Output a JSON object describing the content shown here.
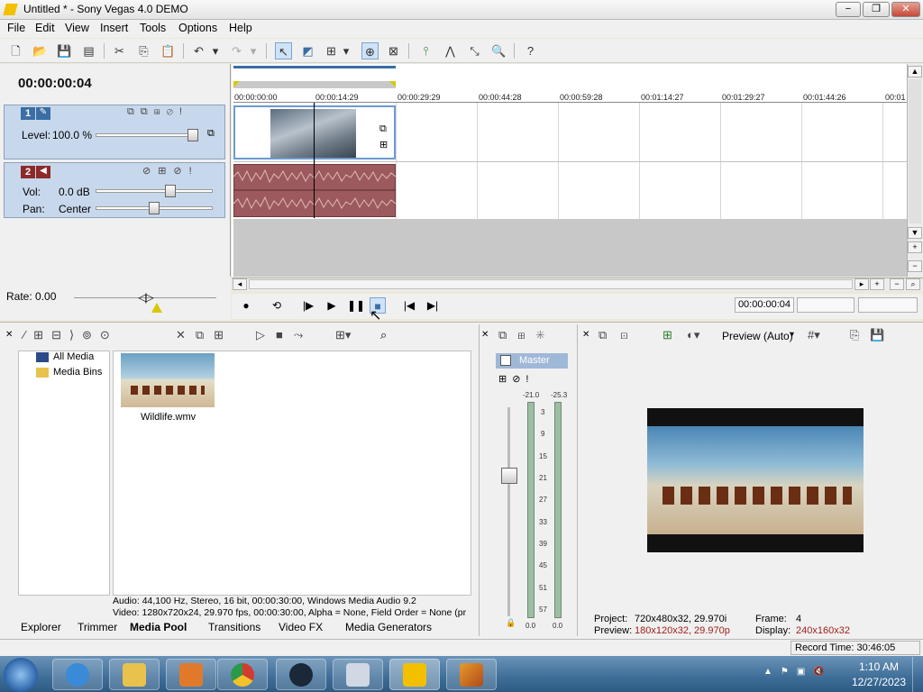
{
  "window": {
    "title": "Untitled * - Sony Vegas 4.0 DEMO",
    "minimize": "−",
    "restore": "❐",
    "close": "✕"
  },
  "menu": [
    "File",
    "Edit",
    "View",
    "Insert",
    "Tools",
    "Options",
    "Help"
  ],
  "timecode": "00:00:00:04",
  "tracks": {
    "video": {
      "number": "1",
      "level_label": "Level:",
      "level_value": "100.0 %"
    },
    "audio": {
      "number": "2",
      "vol_label": "Vol:",
      "vol_value": "0.0 dB",
      "pan_label": "Pan:",
      "pan_value": "Center"
    }
  },
  "ruler": [
    "00:00:00:00",
    "00:00:14:29",
    "00:00:29:29",
    "00:00:44:28",
    "00:00:59:28",
    "00:01:14:27",
    "00:01:29:27",
    "00:01:44:26",
    "00:01"
  ],
  "rate": {
    "label": "Rate: 0.00"
  },
  "transport": {
    "position": "00:00:00:04"
  },
  "media_pool": {
    "tree": [
      "All Media",
      "Media Bins"
    ],
    "file": "Wildlife.wmv",
    "audio_info": "Audio: 44,100 Hz, Stereo, 16 bit, 00:00:30:00, Windows Media Audio 9.2",
    "video_info": "Video: 1280x720x24, 29.970 fps, 00:00:30:00, Alpha = None, Field Order = None (pr"
  },
  "tabs": [
    "Explorer",
    "Trimmer",
    "Media Pool",
    "Transitions",
    "Video FX",
    "Media Generators"
  ],
  "mixer": {
    "master_label": "Master",
    "peak_left": "-21.0",
    "peak_right": "-25.3",
    "scale": [
      "3",
      "9",
      "15",
      "21",
      "27",
      "33",
      "39",
      "45",
      "51",
      "57"
    ],
    "bottom_left": "0.0",
    "bottom_right": "0.0"
  },
  "preview": {
    "mode": "Preview (Auto)",
    "project_label": "Project:",
    "project_value": "720x480x32, 29.970i",
    "preview_label": "Preview:",
    "preview_value": "180x120x32, 29.970p",
    "frame_label": "Frame:",
    "frame_value": "4",
    "display_label": "Display:",
    "display_value": "240x160x32"
  },
  "status": {
    "record_time": "Record Time: 30:46:05"
  },
  "taskbar": {
    "time": "1:10 AM",
    "date": "12/27/2023"
  },
  "colors": {
    "accent": "#3a6ea5",
    "preview_red": "#a0201c",
    "video_track": "#c8d8ec",
    "audio_clip": "#9c5a5e"
  }
}
